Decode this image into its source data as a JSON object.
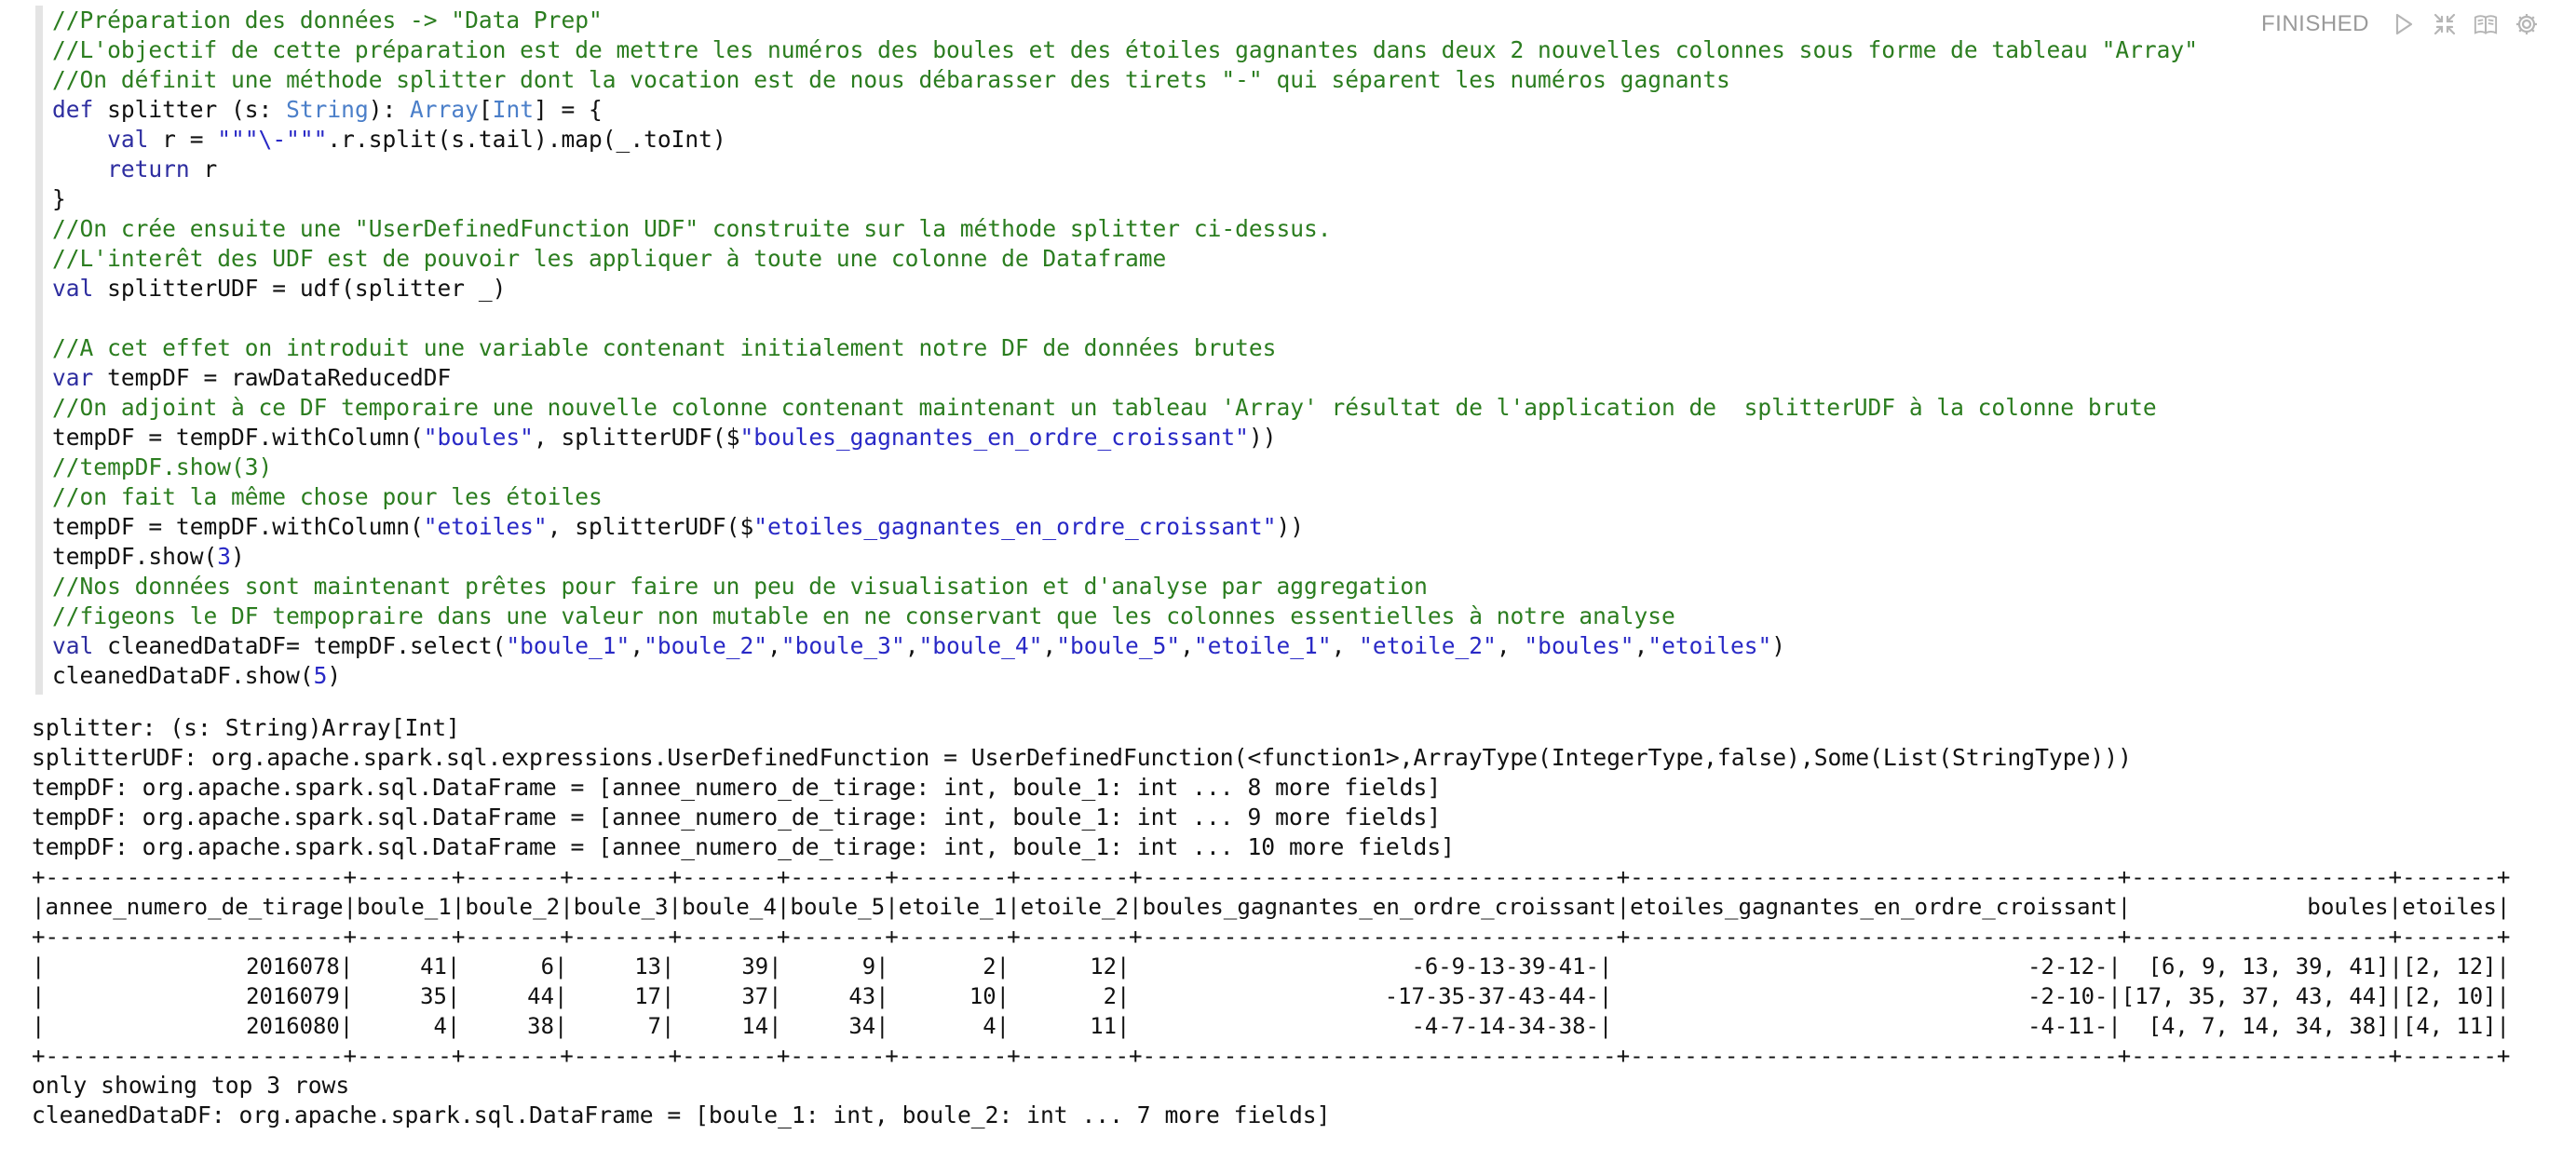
{
  "paragraph": {
    "status": "FINISHED",
    "toolbar_icons": [
      "run-icon",
      "collapse-icon",
      "book-icon",
      "gear-icon"
    ],
    "code_lines": [
      [
        {
          "t": "//Préparation des données -> \"Data Prep\"",
          "c": "cm"
        }
      ],
      [
        {
          "t": "//L'objectif de cette préparation est de mettre les numéros des boules et des étoiles gagnantes dans deux 2 nouvelles colonnes sous forme de tableau \"Array\"",
          "c": "cm"
        }
      ],
      [
        {
          "t": "//On définit une méthode splitter dont la vocation est de nous débarasser des tirets \"-\" qui séparent les numéros gagnants",
          "c": "cm"
        }
      ],
      [
        {
          "t": "def",
          "c": "kw"
        },
        {
          "t": " splitter (s: ",
          "c": "pl"
        },
        {
          "t": "String",
          "c": "ty"
        },
        {
          "t": "): ",
          "c": "pl"
        },
        {
          "t": "Array",
          "c": "ty"
        },
        {
          "t": "[",
          "c": "pl"
        },
        {
          "t": "Int",
          "c": "ty"
        },
        {
          "t": "] = {",
          "c": "pl"
        }
      ],
      [
        {
          "t": "    ",
          "c": "pl"
        },
        {
          "t": "val",
          "c": "kw"
        },
        {
          "t": " r = ",
          "c": "pl"
        },
        {
          "t": "\"\"\"\\-\"\"\"",
          "c": "st"
        },
        {
          "t": ".r.split(s.tail).map(_.toInt)",
          "c": "pl"
        }
      ],
      [
        {
          "t": "    ",
          "c": "pl"
        },
        {
          "t": "return",
          "c": "kw"
        },
        {
          "t": " r",
          "c": "pl"
        }
      ],
      [
        {
          "t": "}",
          "c": "pl"
        }
      ],
      [
        {
          "t": "//On crée ensuite une \"UserDefinedFunction UDF\" construite sur la méthode splitter ci-dessus.",
          "c": "cm"
        }
      ],
      [
        {
          "t": "//L'interêt des UDF est de pouvoir les appliquer à toute une colonne de Dataframe",
          "c": "cm"
        }
      ],
      [
        {
          "t": "val",
          "c": "kw"
        },
        {
          "t": " splitterUDF = udf(splitter _)",
          "c": "pl"
        }
      ],
      [
        {
          "t": "",
          "c": "pl"
        }
      ],
      [
        {
          "t": "//A cet effet on introduit une variable contenant initialement notre DF de données brutes",
          "c": "cm"
        }
      ],
      [
        {
          "t": "var",
          "c": "kw"
        },
        {
          "t": " tempDF = rawDataReducedDF",
          "c": "pl"
        }
      ],
      [
        {
          "t": "//On adjoint à ce DF temporaire une nouvelle colonne contenant maintenant un tableau 'Array' résultat de l'application de  splitterUDF à la colonne brute",
          "c": "cm"
        }
      ],
      [
        {
          "t": "tempDF = tempDF.withColumn(",
          "c": "pl"
        },
        {
          "t": "\"boules\"",
          "c": "st"
        },
        {
          "t": ", splitterUDF($",
          "c": "pl"
        },
        {
          "t": "\"boules_gagnantes_en_ordre_croissant\"",
          "c": "st"
        },
        {
          "t": "))",
          "c": "pl"
        }
      ],
      [
        {
          "t": "//tempDF.show(3)",
          "c": "cm"
        }
      ],
      [
        {
          "t": "//on fait la même chose pour les étoiles",
          "c": "cm"
        }
      ],
      [
        {
          "t": "tempDF = tempDF.withColumn(",
          "c": "pl"
        },
        {
          "t": "\"etoiles\"",
          "c": "st"
        },
        {
          "t": ", splitterUDF($",
          "c": "pl"
        },
        {
          "t": "\"etoiles_gagnantes_en_ordre_croissant\"",
          "c": "st"
        },
        {
          "t": "))",
          "c": "pl"
        }
      ],
      [
        {
          "t": "tempDF.show(",
          "c": "pl"
        },
        {
          "t": "3",
          "c": "nm"
        },
        {
          "t": ")",
          "c": "pl"
        }
      ],
      [
        {
          "t": "//Nos données sont maintenant prêtes pour faire un peu de visualisation et d'analyse par aggregation",
          "c": "cm"
        }
      ],
      [
        {
          "t": "//figeons le DF tempopraire dans une valeur non mutable en ne conservant que les colonnes essentielles à notre analyse",
          "c": "cm"
        }
      ],
      [
        {
          "t": "val",
          "c": "kw"
        },
        {
          "t": " cleanedDataDF= tempDF.select(",
          "c": "pl"
        },
        {
          "t": "\"boule_1\"",
          "c": "st"
        },
        {
          "t": ",",
          "c": "pl"
        },
        {
          "t": "\"boule_2\"",
          "c": "st"
        },
        {
          "t": ",",
          "c": "pl"
        },
        {
          "t": "\"boule_3\"",
          "c": "st"
        },
        {
          "t": ",",
          "c": "pl"
        },
        {
          "t": "\"boule_4\"",
          "c": "st"
        },
        {
          "t": ",",
          "c": "pl"
        },
        {
          "t": "\"boule_5\"",
          "c": "st"
        },
        {
          "t": ",",
          "c": "pl"
        },
        {
          "t": "\"etoile_1\"",
          "c": "st"
        },
        {
          "t": ", ",
          "c": "pl"
        },
        {
          "t": "\"etoile_2\"",
          "c": "st"
        },
        {
          "t": ", ",
          "c": "pl"
        },
        {
          "t": "\"boules\"",
          "c": "st"
        },
        {
          "t": ",",
          "c": "pl"
        },
        {
          "t": "\"etoiles\"",
          "c": "st"
        },
        {
          "t": ")",
          "c": "pl"
        }
      ],
      [
        {
          "t": "cleanedDataDF.show(",
          "c": "pl"
        },
        {
          "t": "5",
          "c": "nm"
        },
        {
          "t": ")",
          "c": "pl"
        }
      ]
    ],
    "output_lines": [
      "splitter: (s: String)Array[Int]",
      "splitterUDF: org.apache.spark.sql.expressions.UserDefinedFunction = UserDefinedFunction(<function1>,ArrayType(IntegerType,false),Some(List(StringType)))",
      "tempDF: org.apache.spark.sql.DataFrame = [annee_numero_de_tirage: int, boule_1: int ... 8 more fields]",
      "tempDF: org.apache.spark.sql.DataFrame = [annee_numero_de_tirage: int, boule_1: int ... 9 more fields]",
      "tempDF: org.apache.spark.sql.DataFrame = [annee_numero_de_tirage: int, boule_1: int ... 10 more fields]",
      "+----------------------+-------+-------+-------+-------+-------+--------+--------+-----------------------------------+------------------------------------+-------------------+-------+",
      "|annee_numero_de_tirage|boule_1|boule_2|boule_3|boule_4|boule_5|etoile_1|etoile_2|boules_gagnantes_en_ordre_croissant|etoiles_gagnantes_en_ordre_croissant|             boules|etoiles|",
      "+----------------------+-------+-------+-------+-------+-------+--------+--------+-----------------------------------+------------------------------------+-------------------+-------+",
      "|               2016078|     41|      6|     13|     39|      9|       2|      12|                     -6-9-13-39-41-|                               -2-12-|  [6, 9, 13, 39, 41]|[2, 12]|",
      "|               2016079|     35|     44|     17|     37|     43|      10|       2|                   -17-35-37-43-44-|                               -2-10-|[17, 35, 37, 43, 44]|[2, 10]|",
      "|               2016080|      4|     38|      7|     14|     34|       4|      11|                     -4-7-14-34-38-|                               -4-11-|  [4, 7, 14, 34, 38]|[4, 11]|",
      "+----------------------+-------+-------+-------+-------+-------+--------+--------+-----------------------------------+------------------------------------+-------------------+-------+",
      "only showing top 3 rows",
      "cleanedDataDF: org.apache.spark.sql.DataFrame = [boule_1: int, boule_2: int ... 7 more fields]"
    ]
  }
}
